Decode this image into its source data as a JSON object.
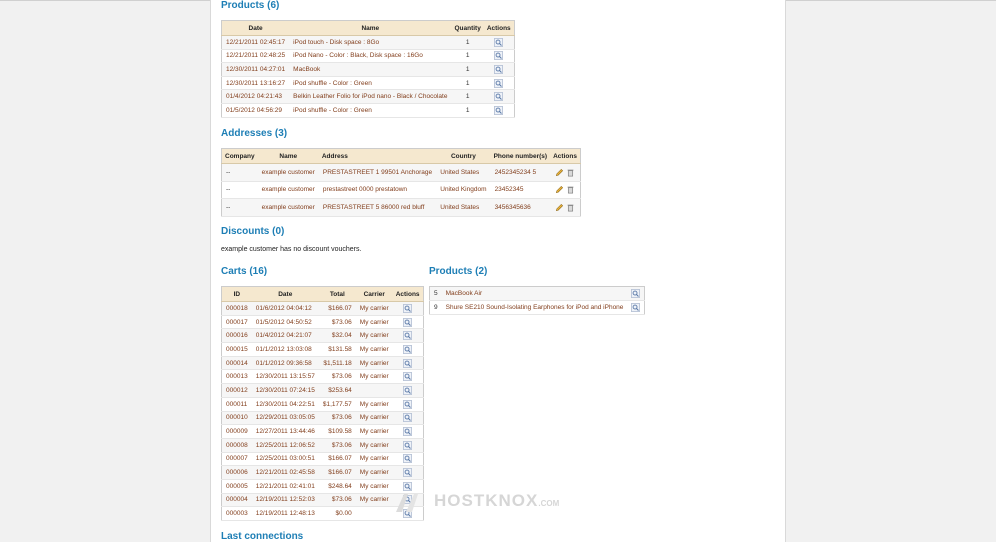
{
  "products_section": {
    "title": "Products (6)",
    "headers": [
      "Date",
      "Name",
      "Quantity",
      "Actions"
    ],
    "rows": [
      {
        "date": "12/21/2011 02:45:17",
        "name": "iPod touch - Disk space : 8Go",
        "qty": "1"
      },
      {
        "date": "12/21/2011 02:48:25",
        "name": "iPod Nano - Color : Black, Disk space : 16Go",
        "qty": "1"
      },
      {
        "date": "12/30/2011 04:27:01",
        "name": "MacBook",
        "qty": "1"
      },
      {
        "date": "12/30/2011 13:16:27",
        "name": "iPod shuffle - Color : Green",
        "qty": "1"
      },
      {
        "date": "01/4/2012 04:21:43",
        "name": "Belkin Leather Folio for iPod nano - Black / Chocolate",
        "qty": "1"
      },
      {
        "date": "01/5/2012 04:56:29",
        "name": "iPod shuffle - Color : Green",
        "qty": "1"
      }
    ]
  },
  "addresses_section": {
    "title": "Addresses (3)",
    "headers": [
      "Company",
      "Name",
      "Address",
      "Country",
      "Phone number(s)",
      "Actions"
    ],
    "rows": [
      {
        "company": "--",
        "name": "example customer",
        "address": "PRESTASTREET 1 99501 Anchorage",
        "country": "United States",
        "phone": "2452345234 5"
      },
      {
        "company": "--",
        "name": "example customer",
        "address": "prestastreet 0000 prestatown",
        "country": "United Kingdom",
        "phone": "23452345"
      },
      {
        "company": "--",
        "name": "example customer",
        "address": "PRESTASTREET 5 86000 red bluff",
        "country": "United States",
        "phone": "3456345636"
      }
    ]
  },
  "discounts_section": {
    "title": "Discounts (0)",
    "note": "example customer has no discount vouchers."
  },
  "carts_section": {
    "title": "Carts (16)",
    "headers": [
      "ID",
      "Date",
      "Total",
      "Carrier",
      "Actions"
    ],
    "rows": [
      {
        "id": "000018",
        "date": "01/6/2012 04:04:12",
        "total": "$166.07",
        "carrier": "My carrier"
      },
      {
        "id": "000017",
        "date": "01/5/2012 04:50:52",
        "total": "$73.06",
        "carrier": "My carrier"
      },
      {
        "id": "000016",
        "date": "01/4/2012 04:21:07",
        "total": "$32.04",
        "carrier": "My carrier"
      },
      {
        "id": "000015",
        "date": "01/1/2012 13:03:08",
        "total": "$131.58",
        "carrier": "My carrier"
      },
      {
        "id": "000014",
        "date": "01/1/2012 09:36:58",
        "total": "$1,511.18",
        "carrier": "My carrier"
      },
      {
        "id": "000013",
        "date": "12/30/2011 13:15:57",
        "total": "$73.06",
        "carrier": "My carrier"
      },
      {
        "id": "000012",
        "date": "12/30/2011 07:24:15",
        "total": "$253.64",
        "carrier": ""
      },
      {
        "id": "000011",
        "date": "12/30/2011 04:22:51",
        "total": "$1,177.57",
        "carrier": "My carrier"
      },
      {
        "id": "000010",
        "date": "12/29/2011 03:05:05",
        "total": "$73.06",
        "carrier": "My carrier"
      },
      {
        "id": "000009",
        "date": "12/27/2011 13:44:46",
        "total": "$109.58",
        "carrier": "My carrier"
      },
      {
        "id": "000008",
        "date": "12/25/2011 12:06:52",
        "total": "$73.06",
        "carrier": "My carrier"
      },
      {
        "id": "000007",
        "date": "12/25/2011 03:00:51",
        "total": "$166.07",
        "carrier": "My carrier"
      },
      {
        "id": "000006",
        "date": "12/21/2011 02:45:58",
        "total": "$166.07",
        "carrier": "My carrier"
      },
      {
        "id": "000005",
        "date": "12/21/2011 02:41:01",
        "total": "$248.64",
        "carrier": "My carrier"
      },
      {
        "id": "000004",
        "date": "12/19/2011 12:52:03",
        "total": "$73.06",
        "carrier": "My carrier"
      },
      {
        "id": "000003",
        "date": "12/19/2011 12:48:13",
        "total": "$0.00",
        "carrier": ""
      }
    ]
  },
  "cart_products_section": {
    "title": "Products (2)",
    "rows": [
      {
        "id": "5",
        "name": "MacBook Air"
      },
      {
        "id": "9",
        "name": "Shure SE210 Sound-Isolating Earphones for iPod and iPhone"
      }
    ]
  },
  "last_connections": {
    "title": "Last connections"
  },
  "watermark": {
    "text": "HOSTKNOX",
    "suffix": ".COM"
  },
  "colors": {
    "heading": "#1d7eb5",
    "table_header": "#f5e8cf",
    "row_text": "#813d1b"
  },
  "icons": {
    "view": "magnifier-icon",
    "edit": "pencil-icon",
    "delete": "trash-icon"
  }
}
